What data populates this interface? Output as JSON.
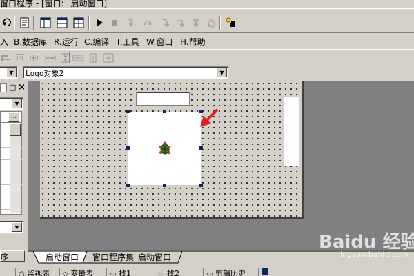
{
  "window": {
    "title": "窗口程序 - [窗口: _启动窗口]"
  },
  "toolbar": {
    "icons": [
      "undo-icon",
      "redo-icon",
      "print-preview-icon",
      "window-layout-icon",
      "window-split-icon",
      "table-icon",
      "run-icon",
      "stop-icon",
      "step-in-icon",
      "step-over-icon",
      "step-out-icon",
      "step-back-icon",
      "hand-icon",
      "find-icon"
    ]
  },
  "menu": {
    "items": [
      {
        "prefix": "",
        "key": "入",
        "rest": ""
      },
      {
        "prefix": "",
        "key": "B",
        "rest": ".数据库"
      },
      {
        "prefix": "",
        "key": "R",
        "rest": ".运行"
      },
      {
        "prefix": "",
        "key": "C",
        "rest": ".编译"
      },
      {
        "prefix": "",
        "key": "T",
        "rest": ".工具"
      },
      {
        "prefix": "",
        "key": "W",
        "rest": ".窗口"
      },
      {
        "prefix": "",
        "key": "H",
        "rest": ".帮助"
      }
    ]
  },
  "object_selector": {
    "value": "Logo对象2"
  },
  "left_panel": {
    "close_label": "×",
    "pin_label": "□",
    "more_label": "...",
    "bottom_label": "序"
  },
  "tabs": [
    {
      "label": "_启动窗口"
    },
    {
      "label": "窗口程序集_启动窗口"
    }
  ],
  "status": {
    "items": [
      "监视表",
      "变量表",
      "找1",
      "找2",
      "剪辑历史"
    ]
  },
  "watermark": {
    "text": "Baidu 经验",
    "sub": "jingyan.baidu.com"
  },
  "colors": {
    "selection_handle": "#0a246a",
    "arrow": "#e0201a",
    "design_bg": "#d4d0c8",
    "mdi_bg": "#808080"
  }
}
